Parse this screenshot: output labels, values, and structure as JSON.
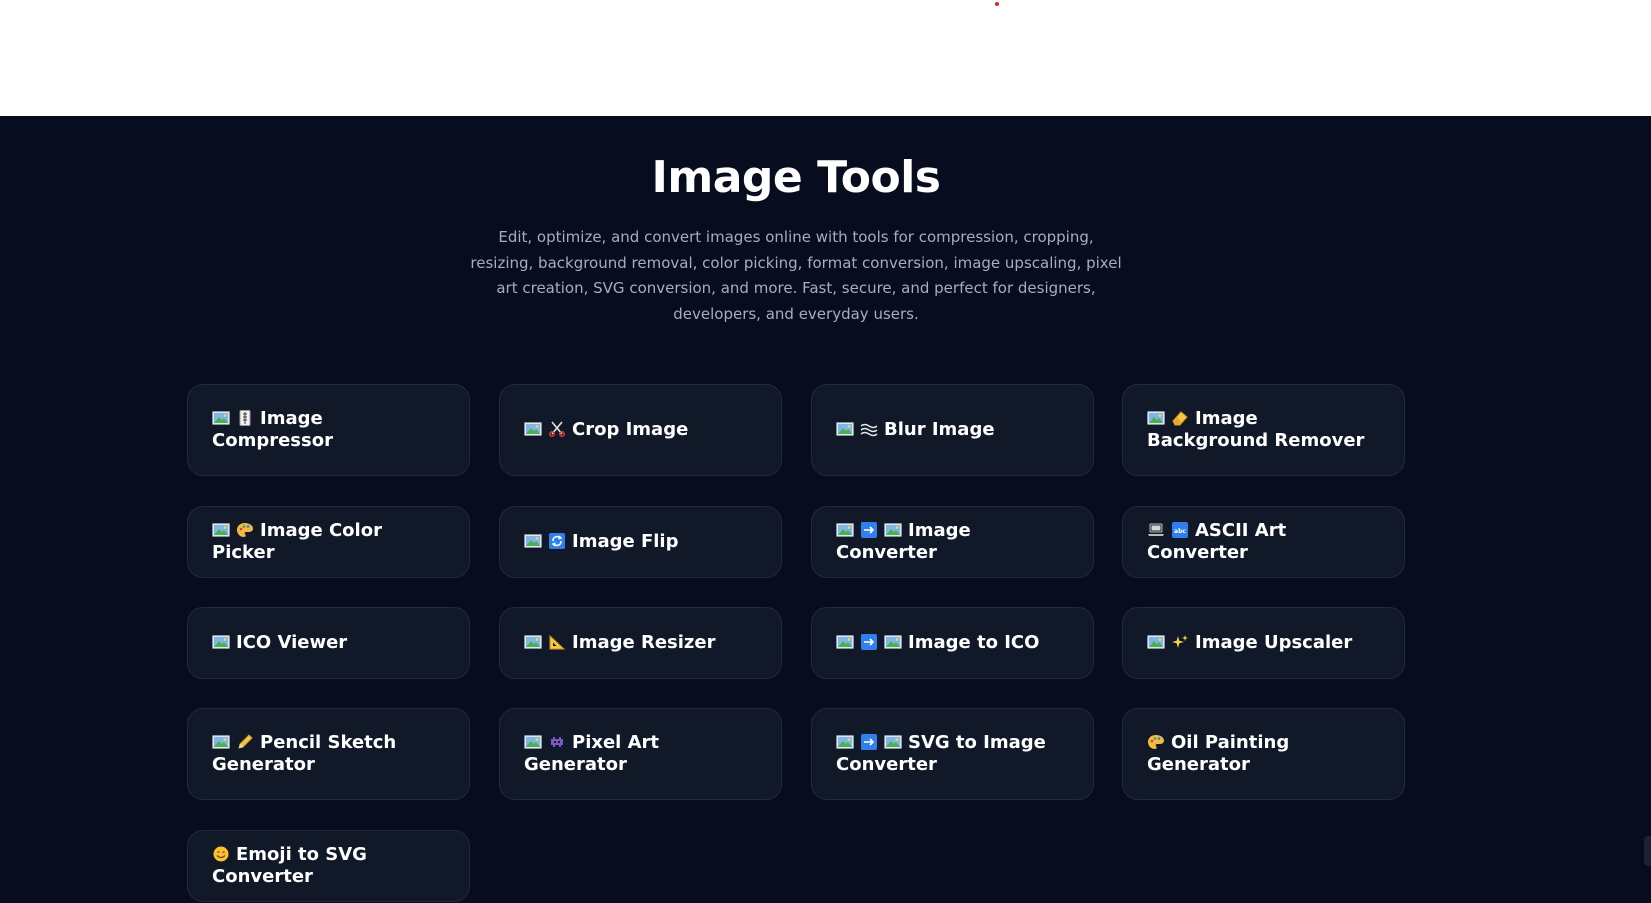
{
  "header": {
    "title": "Image Tools",
    "description": "Edit, optimize, and convert images online with tools for compression, cropping, resizing, background removal, color picking, format conversion, image upscaling, pixel art creation, SVG conversion, and more. Fast, secure, and perfect for designers, developers, and everyday users."
  },
  "tools": [
    {
      "label": "Image Compressor",
      "icons": [
        "picture-icon",
        "compress-icon"
      ]
    },
    {
      "label": "Crop Image",
      "icons": [
        "picture-icon",
        "scissors-icon"
      ]
    },
    {
      "label": "Blur Image",
      "icons": [
        "picture-icon",
        "waves-icon"
      ]
    },
    {
      "label": "Image Background Remover",
      "icons": [
        "picture-icon",
        "eraser-icon"
      ]
    },
    {
      "label": "Image Color Picker",
      "icons": [
        "picture-icon",
        "palette-icon"
      ]
    },
    {
      "label": "Image Flip",
      "icons": [
        "picture-icon",
        "flip-arrows-icon"
      ]
    },
    {
      "label": "Image Converter",
      "icons": [
        "picture-icon",
        "right-arrow-icon",
        "picture-icon"
      ]
    },
    {
      "label": "ASCII Art Converter",
      "icons": [
        "laptop-icon",
        "abc-icon"
      ]
    },
    {
      "label": "ICO Viewer",
      "icons": [
        "picture-icon"
      ]
    },
    {
      "label": "Image Resizer",
      "icons": [
        "picture-icon",
        "triangle-ruler-icon"
      ]
    },
    {
      "label": "Image to ICO",
      "icons": [
        "picture-icon",
        "right-arrow-icon",
        "picture-icon"
      ]
    },
    {
      "label": "Image Upscaler",
      "icons": [
        "picture-icon",
        "sparkles-icon"
      ]
    },
    {
      "label": "Pencil Sketch Generator",
      "icons": [
        "picture-icon",
        "pencil-icon"
      ]
    },
    {
      "label": "Pixel Art Generator",
      "icons": [
        "picture-icon",
        "space-invader-icon"
      ]
    },
    {
      "label": "SVG to Image Converter",
      "icons": [
        "picture-icon",
        "right-arrow-icon",
        "picture-icon"
      ]
    },
    {
      "label": "Oil Painting Generator",
      "icons": [
        "palette-icon"
      ]
    },
    {
      "label": "Emoji to SVG Converter",
      "icons": [
        "smiley-icon"
      ]
    }
  ],
  "colors": {
    "background": "#070d1f",
    "card": "#111827",
    "card_border": "#1f2a3d",
    "title": "#ffffff",
    "description": "#a7adbf"
  }
}
